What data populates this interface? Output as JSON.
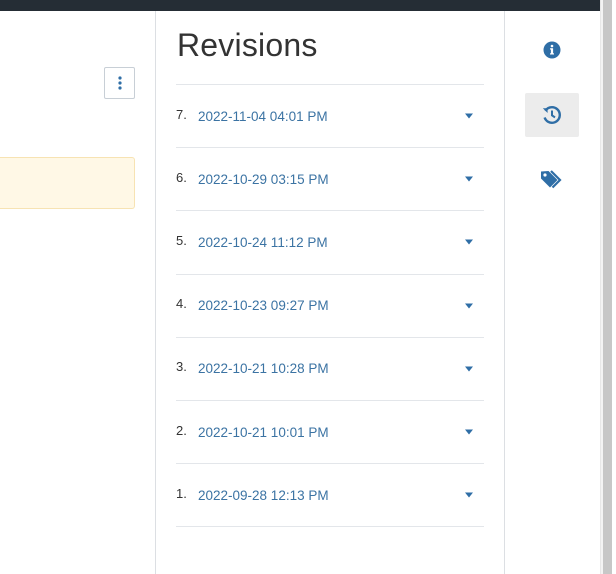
{
  "revisions_panel": {
    "title": "Revisions",
    "items": [
      {
        "number": "7.",
        "date": "2022-11-04 04:01 PM"
      },
      {
        "number": "6.",
        "date": "2022-10-29 03:15 PM"
      },
      {
        "number": "5.",
        "date": "2022-10-24 11:12 PM"
      },
      {
        "number": "4.",
        "date": "2022-10-23 09:27 PM"
      },
      {
        "number": "3.",
        "date": "2022-10-21 10:28 PM"
      },
      {
        "number": "2.",
        "date": "2022-10-21 10:01 PM"
      },
      {
        "number": "1.",
        "date": "2022-09-28 12:13 PM"
      }
    ]
  },
  "sidebar": {
    "buttons": [
      {
        "icon": "info-icon",
        "active": false
      },
      {
        "icon": "history-icon",
        "active": true
      },
      {
        "icon": "tags-icon",
        "active": false
      }
    ]
  },
  "main": {
    "more_button_icon": "vertical-ellipsis-icon"
  },
  "colors": {
    "topbar": "#252d35",
    "accent": "#2f6ea6",
    "link": "#3b73a3",
    "notice_bg": "#fff8e6",
    "active_bg": "#ececec"
  }
}
